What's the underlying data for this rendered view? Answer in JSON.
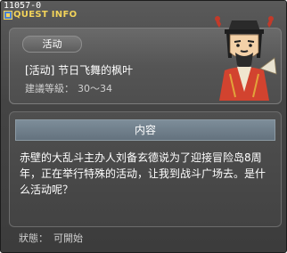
{
  "window": {
    "id_label": "11057-0",
    "title": "QUEST INFO"
  },
  "quest": {
    "tag": "活动",
    "name": "[活动] 节日飞舞的枫叶",
    "level_label": "建議等級：",
    "level_range": "30～34"
  },
  "content": {
    "header": "内容",
    "text": "赤壁的大乱斗主办人刘备玄德说为了迎接冒险岛8周年，正在举行特殊的活动，让我到战斗广场去。是什么活动呢？"
  },
  "status": {
    "label": "狀態：",
    "value": "可開始"
  },
  "colors": {
    "title_text": "#f2d35a",
    "window_bg": "#444444",
    "header_bg": "#6e7c88"
  },
  "icons": {
    "title_icon": "quest-window-icon",
    "npc": "npc-liu-bei-portrait"
  }
}
